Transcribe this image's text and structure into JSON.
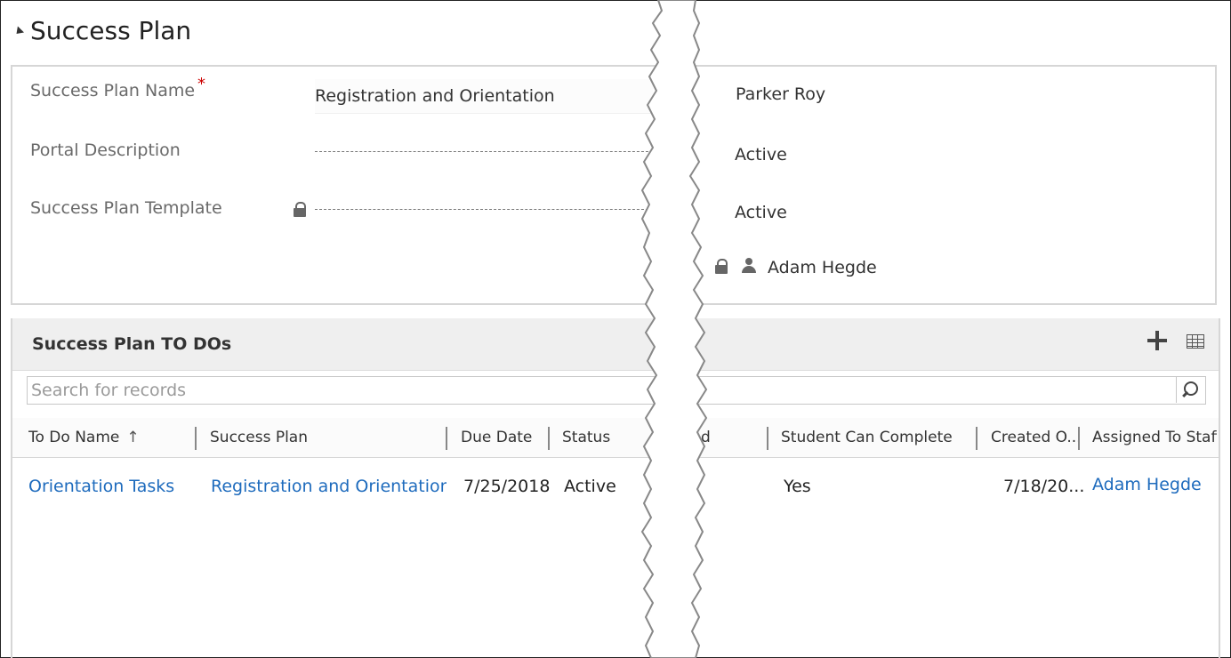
{
  "section": {
    "title": "Success Plan"
  },
  "form": {
    "name_label": "Success Plan Name",
    "required_mark": "*",
    "name_value": "Registration and Orientation",
    "portal_description_label": "Portal Description",
    "template_label": "Success Plan Template",
    "right_values": {
      "owner": "Parker Roy",
      "status_1": "Active",
      "status_2": "Active",
      "assigned_staff": "Adam Hegde"
    }
  },
  "grid": {
    "title": "Success Plan TO DOs",
    "search_placeholder": "Search for records",
    "columns": [
      {
        "label": "To Do Name",
        "sort": "↑"
      },
      {
        "label": "Success Plan"
      },
      {
        "label": "Due Date"
      },
      {
        "label": "Status"
      },
      {
        "label": "d"
      },
      {
        "label": "Student Can Complete"
      },
      {
        "label": "Created O..."
      },
      {
        "label": "Assigned To Staff"
      }
    ],
    "rows": [
      {
        "todo_name": "Orientation Tasks",
        "success_plan": "Registration and Orientation",
        "due_date": "7/25/2018",
        "status": "Active",
        "student_can_complete": "Yes",
        "created_on": "7/18/20...",
        "assigned_to_staff": "Adam Hegde"
      }
    ]
  },
  "icons": {
    "collapse": "collapse-triangle-icon",
    "lock": "lock-icon",
    "person": "person-icon",
    "add": "plus-icon",
    "grid_view": "grid-view-icon",
    "search": "search-icon"
  },
  "colors": {
    "link": "#1e6bbd",
    "required": "#cc0000",
    "header_bg": "#efefef"
  }
}
